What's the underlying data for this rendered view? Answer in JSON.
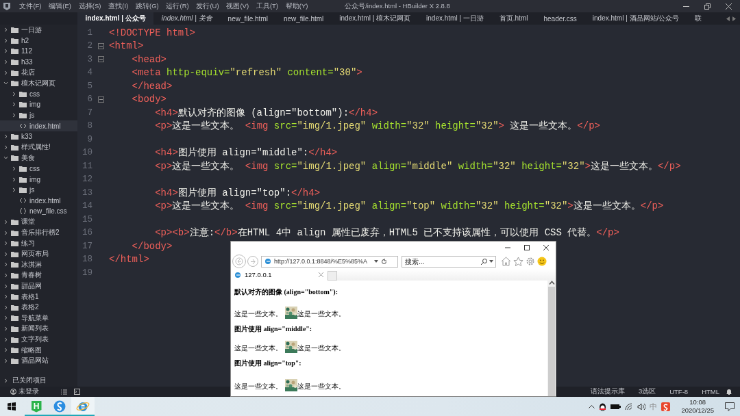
{
  "window": {
    "title": "公众号/index.html - HBuilder X 2.8.8"
  },
  "menu": [
    "文件(F)",
    "编辑(E)",
    "选择(S)",
    "查找(I)",
    "跳转(G)",
    "运行(R)",
    "发行(U)",
    "视图(V)",
    "工具(T)",
    "帮助(Y)"
  ],
  "tabs": [
    {
      "label": "index.html | 公众号",
      "selected": true,
      "italic": false
    },
    {
      "label": "index.html | 美食",
      "selected": false,
      "italic": true
    },
    {
      "label": "new_file.html",
      "selected": false,
      "italic": false
    },
    {
      "label": "new_file.html",
      "selected": false,
      "italic": false
    },
    {
      "label": "index.html | 檀木记网页",
      "selected": false,
      "italic": false
    },
    {
      "label": "index.html | 一日游",
      "selected": false,
      "italic": false
    },
    {
      "label": "首页.html",
      "selected": false,
      "italic": false
    },
    {
      "label": "header.css",
      "selected": false,
      "italic": false
    },
    {
      "label": "index.html | 酒品网站/公众号",
      "selected": false,
      "italic": false
    },
    {
      "label": "联",
      "selected": false,
      "italic": false
    }
  ],
  "sidebar": {
    "items": [
      {
        "label": "一日游",
        "kind": "folder",
        "expanded": false,
        "selected": false
      },
      {
        "label": "h2",
        "kind": "folder",
        "expanded": false,
        "selected": false
      },
      {
        "label": "112",
        "kind": "folder",
        "expanded": false,
        "selected": false
      },
      {
        "label": "h33",
        "kind": "folder",
        "expanded": false,
        "selected": false
      },
      {
        "label": "花店",
        "kind": "folder",
        "expanded": false,
        "selected": false
      },
      {
        "label": "檀木记网页",
        "kind": "folder",
        "expanded": true,
        "selected": false,
        "children": [
          {
            "label": "css",
            "kind": "folder",
            "expanded": false,
            "selected": false
          },
          {
            "label": "img",
            "kind": "folder",
            "expanded": false,
            "selected": false
          },
          {
            "label": "js",
            "kind": "folder",
            "expanded": false,
            "selected": false
          },
          {
            "label": "index.html",
            "kind": "html",
            "selected": true
          }
        ]
      },
      {
        "label": "k33",
        "kind": "folder",
        "expanded": false,
        "selected": false
      },
      {
        "label": "样式属性!",
        "kind": "folder",
        "expanded": false,
        "selected": false
      },
      {
        "label": "美食",
        "kind": "folder",
        "expanded": true,
        "selected": false,
        "children": [
          {
            "label": "css",
            "kind": "folder",
            "expanded": false,
            "selected": false
          },
          {
            "label": "img",
            "kind": "folder",
            "expanded": false,
            "selected": false
          },
          {
            "label": "js",
            "kind": "folder",
            "expanded": false,
            "selected": false
          },
          {
            "label": "index.html",
            "kind": "html",
            "selected": false
          },
          {
            "label": "new_file.css",
            "kind": "css",
            "selected": false
          }
        ]
      },
      {
        "label": "课堂",
        "kind": "folder",
        "expanded": false,
        "selected": false
      },
      {
        "label": "音乐排行榜2",
        "kind": "folder",
        "expanded": false,
        "selected": false
      },
      {
        "label": "练习",
        "kind": "folder",
        "expanded": false,
        "selected": false
      },
      {
        "label": "网页布局",
        "kind": "folder",
        "expanded": false,
        "selected": false
      },
      {
        "label": "冰淇淋",
        "kind": "folder",
        "expanded": false,
        "selected": false
      },
      {
        "label": "青春树",
        "kind": "folder",
        "expanded": false,
        "selected": false
      },
      {
        "label": "甜品网",
        "kind": "folder",
        "expanded": false,
        "selected": false
      },
      {
        "label": "表格1",
        "kind": "folder",
        "expanded": false,
        "selected": false
      },
      {
        "label": "表格2",
        "kind": "folder",
        "expanded": false,
        "selected": false
      },
      {
        "label": "导航菜单",
        "kind": "folder",
        "expanded": false,
        "selected": false
      },
      {
        "label": "新闻列表",
        "kind": "folder",
        "expanded": false,
        "selected": false
      },
      {
        "label": "文字列表",
        "kind": "folder",
        "expanded": false,
        "selected": false
      },
      {
        "label": "缩略图",
        "kind": "folder",
        "expanded": false,
        "selected": false
      },
      {
        "label": "酒品网站",
        "kind": "folder",
        "expanded": false,
        "selected": false
      }
    ],
    "closed_projects": "已关闭项目"
  },
  "code": [
    {
      "number": "1",
      "foldable": false,
      "tokens": [
        {
          "kind": "tag",
          "text": "<!DOCTYPE html>"
        }
      ]
    },
    {
      "number": "2",
      "foldable": true,
      "tokens": [
        {
          "kind": "tag",
          "text": "<html>"
        }
      ]
    },
    {
      "number": "3",
      "foldable": true,
      "tokens": [
        {
          "kind": "tag",
          "text": "    <head>"
        }
      ]
    },
    {
      "number": "4",
      "foldable": false,
      "tokens": [
        {
          "kind": "tag",
          "text": "    <meta "
        },
        {
          "kind": "attr",
          "text": "http-equiv="
        },
        {
          "kind": "string",
          "text": "\"refresh\""
        },
        {
          "kind": "attr",
          "text": " content="
        },
        {
          "kind": "string",
          "text": "\"30\""
        },
        {
          "kind": "tag",
          "text": ">"
        }
      ]
    },
    {
      "number": "5",
      "foldable": false,
      "tokens": [
        {
          "kind": "tag",
          "text": "    </head>"
        }
      ]
    },
    {
      "number": "6",
      "foldable": true,
      "tokens": [
        {
          "kind": "tag",
          "text": "    <body>"
        }
      ]
    },
    {
      "number": "7",
      "foldable": false,
      "tokens": [
        {
          "kind": "tag",
          "text": "        <h4>"
        },
        {
          "kind": "text",
          "text": "默认对齐的图像 (align=\"bottom\"):"
        },
        {
          "kind": "tag",
          "text": "</h4>"
        }
      ]
    },
    {
      "number": "8",
      "foldable": false,
      "tokens": [
        {
          "kind": "tag",
          "text": "        <p>"
        },
        {
          "kind": "text",
          "text": "这是一些文本。 "
        },
        {
          "kind": "tag",
          "text": "<img "
        },
        {
          "kind": "attr",
          "text": "src="
        },
        {
          "kind": "string",
          "text": "\"img/1.jpeg\""
        },
        {
          "kind": "attr",
          "text": " width="
        },
        {
          "kind": "string",
          "text": "\"32\""
        },
        {
          "kind": "attr",
          "text": " height="
        },
        {
          "kind": "string",
          "text": "\"32\""
        },
        {
          "kind": "tag",
          "text": ">"
        },
        {
          "kind": "text",
          "text": " 这是一些文本。"
        },
        {
          "kind": "tag",
          "text": "</p>"
        }
      ]
    },
    {
      "number": "9",
      "foldable": false
    },
    {
      "number": "10",
      "foldable": false,
      "tokens": [
        {
          "kind": "tag",
          "text": "        <h4>"
        },
        {
          "kind": "text",
          "text": "图片使用 align=\"middle\":"
        },
        {
          "kind": "tag",
          "text": "</h4>"
        }
      ]
    },
    {
      "number": "11",
      "foldable": false,
      "tokens": [
        {
          "kind": "tag",
          "text": "        <p>"
        },
        {
          "kind": "text",
          "text": "这是一些文本。 "
        },
        {
          "kind": "tag",
          "text": "<img "
        },
        {
          "kind": "attr",
          "text": "src="
        },
        {
          "kind": "string",
          "text": "\"img/1.jpeg\""
        },
        {
          "kind": "attr",
          "text": " align="
        },
        {
          "kind": "string",
          "text": "\"middle\""
        },
        {
          "kind": "attr",
          "text": " width="
        },
        {
          "kind": "string",
          "text": "\"32\""
        },
        {
          "kind": "attr",
          "text": " height="
        },
        {
          "kind": "string",
          "text": "\"32\""
        },
        {
          "kind": "tag",
          "text": ">"
        },
        {
          "kind": "text",
          "text": "这是一些文本。"
        },
        {
          "kind": "tag",
          "text": "</p>"
        }
      ]
    },
    {
      "number": "12",
      "foldable": false
    },
    {
      "number": "13",
      "foldable": false,
      "tokens": [
        {
          "kind": "tag",
          "text": "        <h4>"
        },
        {
          "kind": "text",
          "text": "图片使用 align=\"top\":"
        },
        {
          "kind": "tag",
          "text": "</h4>"
        }
      ]
    },
    {
      "number": "14",
      "foldable": false,
      "tokens": [
        {
          "kind": "tag",
          "text": "        <p>"
        },
        {
          "kind": "text",
          "text": "这是一些文本。 "
        },
        {
          "kind": "tag",
          "text": "<img "
        },
        {
          "kind": "attr",
          "text": "src="
        },
        {
          "kind": "string",
          "text": "\"img/1.jpeg\""
        },
        {
          "kind": "attr",
          "text": " align="
        },
        {
          "kind": "string",
          "text": "\"top\""
        },
        {
          "kind": "attr",
          "text": " width="
        },
        {
          "kind": "string",
          "text": "\"32\""
        },
        {
          "kind": "attr",
          "text": " height="
        },
        {
          "kind": "string",
          "text": "\"32\""
        },
        {
          "kind": "tag",
          "text": ">"
        },
        {
          "kind": "text",
          "text": "这是一些文本。"
        },
        {
          "kind": "tag",
          "text": "</p>"
        }
      ]
    },
    {
      "number": "15",
      "foldable": false
    },
    {
      "number": "16",
      "foldable": false,
      "tokens": [
        {
          "kind": "tag",
          "text": "        <p><b>"
        },
        {
          "kind": "text",
          "text": "注意:"
        },
        {
          "kind": "tag",
          "text": "</b>"
        },
        {
          "kind": "text",
          "text": "在HTML 4中 align 属性已废弃，HTML5 已不支持该属性，可以使用 CSS 代替。"
        },
        {
          "kind": "tag",
          "text": "</p>"
        }
      ]
    },
    {
      "number": "17",
      "foldable": false,
      "tokens": [
        {
          "kind": "tag",
          "text": "    </body>"
        }
      ]
    },
    {
      "number": "18",
      "foldable": false,
      "tokens": [
        {
          "kind": "tag",
          "text": "</html>"
        }
      ]
    },
    {
      "number": "19",
      "foldable": false
    }
  ],
  "browser": {
    "address": "http://127.0.0.1:8848/%E5%85%A",
    "search_placeholder": "搜索...",
    "tab": "127.0.0.1",
    "page": [
      {
        "kind": "heading",
        "text": "默认对齐的图像 (align=\"bottom\"):"
      },
      {
        "kind": "paragraph",
        "before": "这是一些文本。",
        "image": {
          "kind": "bottom"
        },
        "after": "这是一些文本。"
      },
      {
        "kind": "heading",
        "text": "图片使用 align=\"middle\":"
      },
      {
        "kind": "paragraph",
        "before": "这是一些文本。",
        "image": {
          "kind": "middle"
        },
        "after": "这是一些文本。"
      },
      {
        "kind": "heading",
        "text": "图片使用 align=\"top\":"
      },
      {
        "kind": "paragraph",
        "before": "这是一些文本。",
        "image": {
          "kind": "top"
        },
        "after": "这是一些文本。"
      }
    ]
  },
  "status_bar": {
    "user": "未登录",
    "items": [
      "语法提示库",
      "3选区",
      "UTF-8",
      "HTML"
    ]
  },
  "taskbar": {
    "editor_logo": "H",
    "ime": "中",
    "time": "10:08",
    "date": "2020/12/25"
  }
}
